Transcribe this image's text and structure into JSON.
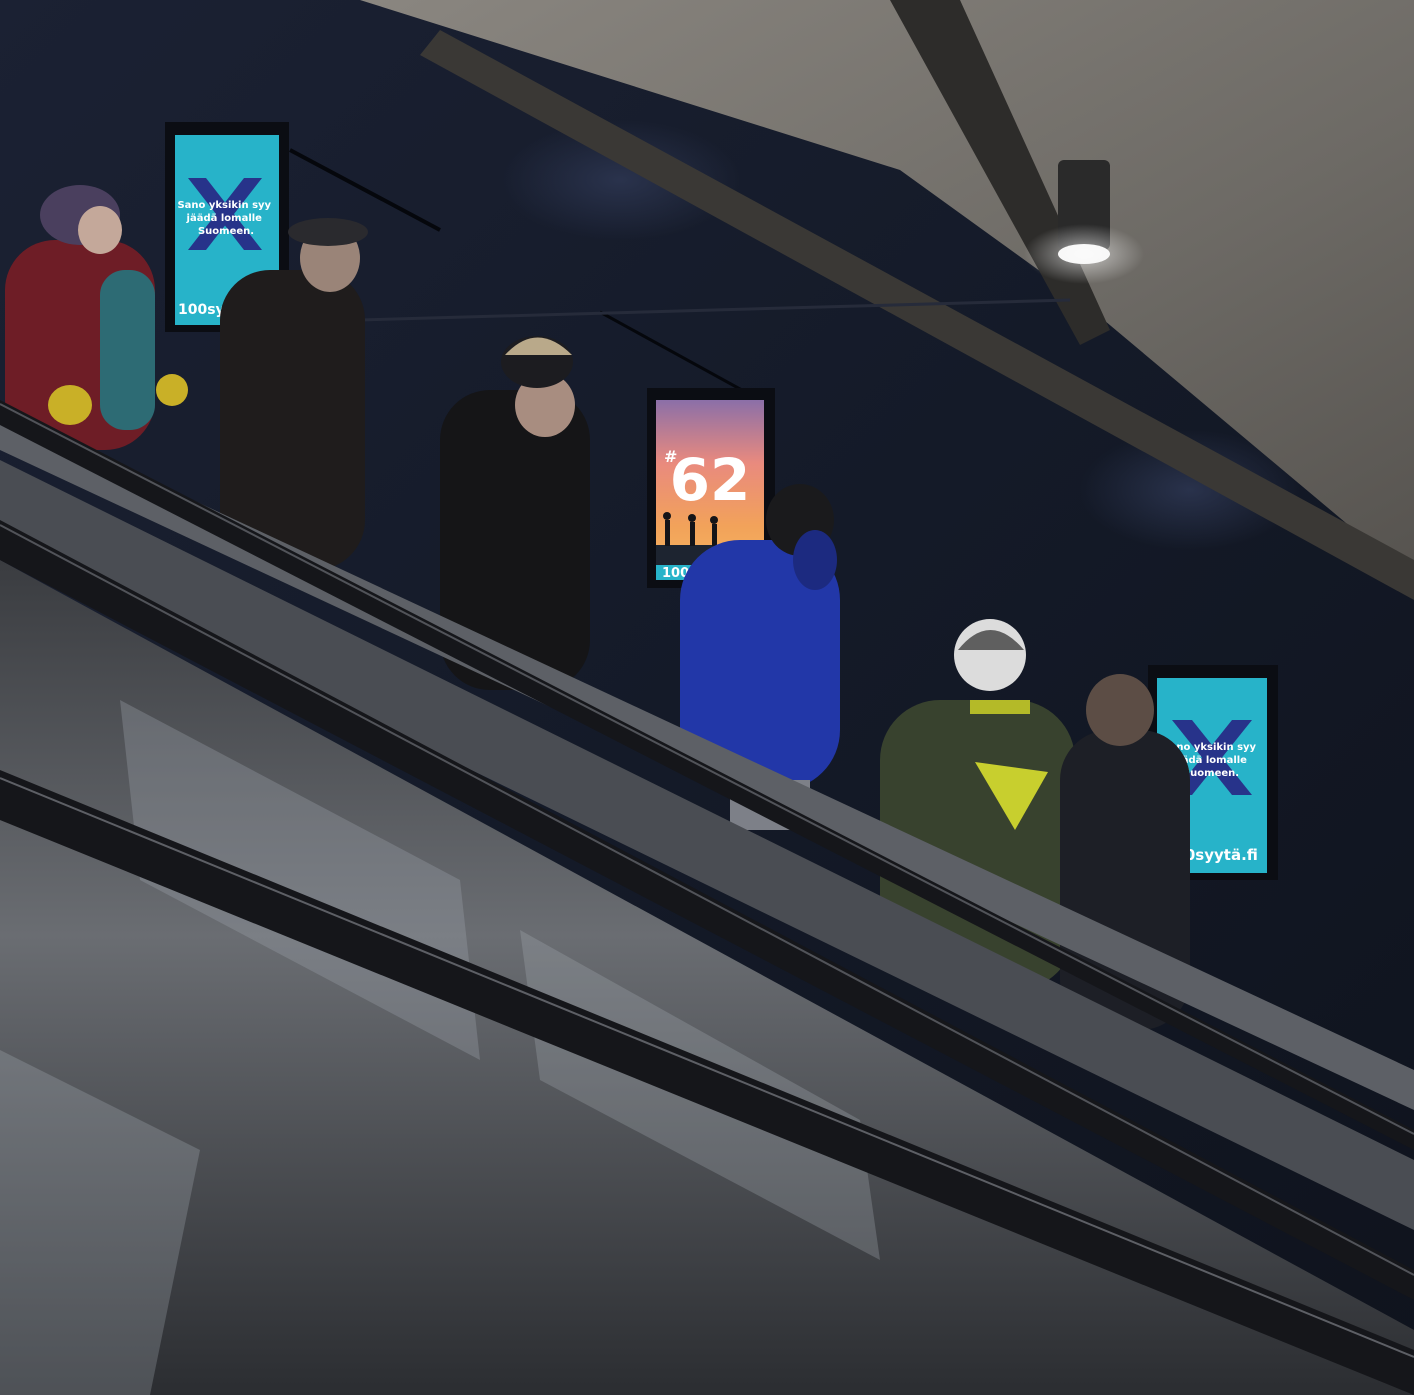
{
  "colors": {
    "wall": "#161b29",
    "ceiling": "#6f6c67",
    "screen_cyan": "#27b3c9",
    "cross_navy": "#27338a",
    "steel": "#55585d",
    "handrail": "#15161a"
  },
  "screens": {
    "left": {
      "message": [
        "Sano yksikin syy",
        "jäädä lomalle",
        "Suomeen."
      ],
      "brand": "100syytä",
      "icon": "x-cross-icon"
    },
    "center": {
      "number": "62",
      "brand": "100sy",
      "icon": "hash-icon"
    },
    "right": {
      "message": [
        "Sano yksikin syy",
        "jäädä lomalle",
        "Suomeen."
      ],
      "brand": "100syytä.fi",
      "icon": "x-cross-icon"
    }
  }
}
